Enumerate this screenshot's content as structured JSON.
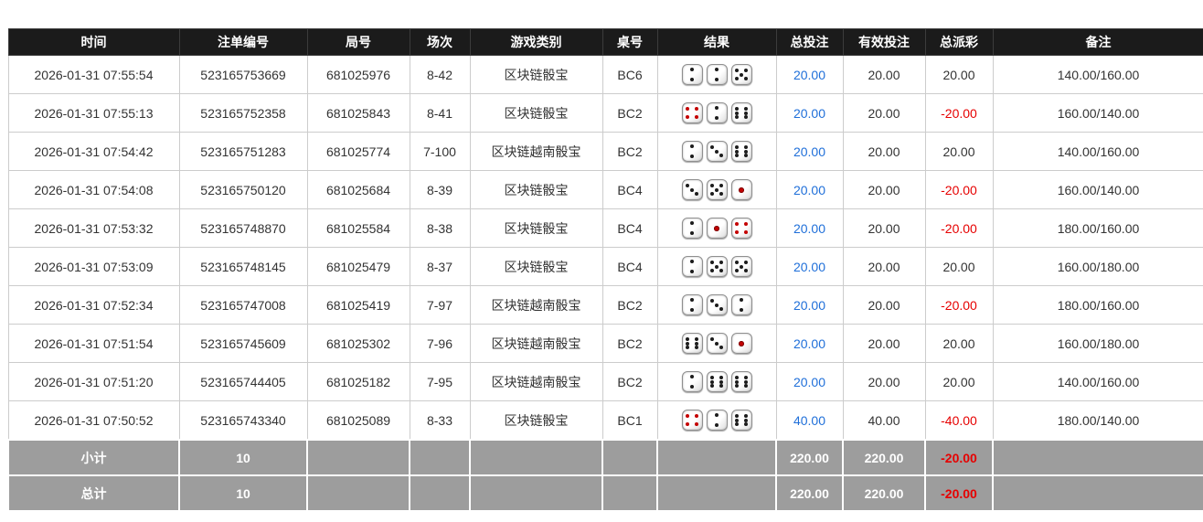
{
  "colors": {
    "link_blue": "#1f6fd9",
    "negative_red": "#e60000",
    "header_bg": "#1b1b1b",
    "summary_bg": "#9d9d9d",
    "grid_border": "#cccccc"
  },
  "table": {
    "headers": [
      "时间",
      "注单编号",
      "局号",
      "场次",
      "游戏类别",
      "桌号",
      "结果",
      "总投注",
      "有效投注",
      "总派彩",
      "备注"
    ],
    "rows": [
      {
        "time": "2026-01-31 07:55:54",
        "bet_id": "523165753669",
        "round_id": "681025976",
        "session": "8-42",
        "game": "区块链骰宝",
        "table_no": "BC6",
        "dice": [
          2,
          2,
          5
        ],
        "total_bet": "20.00",
        "valid_bet": "20.00",
        "payout": "20.00",
        "remark": "140.00/160.00"
      },
      {
        "time": "2026-01-31 07:55:13",
        "bet_id": "523165752358",
        "round_id": "681025843",
        "session": "8-41",
        "game": "区块链骰宝",
        "table_no": "BC2",
        "dice": [
          4,
          2,
          6
        ],
        "total_bet": "20.00",
        "valid_bet": "20.00",
        "payout": "-20.00",
        "remark": "160.00/140.00"
      },
      {
        "time": "2026-01-31 07:54:42",
        "bet_id": "523165751283",
        "round_id": "681025774",
        "session": "7-100",
        "game": "区块链越南骰宝",
        "table_no": "BC2",
        "dice": [
          2,
          3,
          6
        ],
        "total_bet": "20.00",
        "valid_bet": "20.00",
        "payout": "20.00",
        "remark": "140.00/160.00"
      },
      {
        "time": "2026-01-31 07:54:08",
        "bet_id": "523165750120",
        "round_id": "681025684",
        "session": "8-39",
        "game": "区块链骰宝",
        "table_no": "BC4",
        "dice": [
          3,
          5,
          1
        ],
        "total_bet": "20.00",
        "valid_bet": "20.00",
        "payout": "-20.00",
        "remark": "160.00/140.00"
      },
      {
        "time": "2026-01-31 07:53:32",
        "bet_id": "523165748870",
        "round_id": "681025584",
        "session": "8-38",
        "game": "区块链骰宝",
        "table_no": "BC4",
        "dice": [
          2,
          1,
          4
        ],
        "total_bet": "20.00",
        "valid_bet": "20.00",
        "payout": "-20.00",
        "remark": "180.00/160.00"
      },
      {
        "time": "2026-01-31 07:53:09",
        "bet_id": "523165748145",
        "round_id": "681025479",
        "session": "8-37",
        "game": "区块链骰宝",
        "table_no": "BC4",
        "dice": [
          2,
          5,
          5
        ],
        "total_bet": "20.00",
        "valid_bet": "20.00",
        "payout": "20.00",
        "remark": "160.00/180.00"
      },
      {
        "time": "2026-01-31 07:52:34",
        "bet_id": "523165747008",
        "round_id": "681025419",
        "session": "7-97",
        "game": "区块链越南骰宝",
        "table_no": "BC2",
        "dice": [
          2,
          3,
          2
        ],
        "total_bet": "20.00",
        "valid_bet": "20.00",
        "payout": "-20.00",
        "remark": "180.00/160.00"
      },
      {
        "time": "2026-01-31 07:51:54",
        "bet_id": "523165745609",
        "round_id": "681025302",
        "session": "7-96",
        "game": "区块链越南骰宝",
        "table_no": "BC2",
        "dice": [
          6,
          3,
          1
        ],
        "total_bet": "20.00",
        "valid_bet": "20.00",
        "payout": "20.00",
        "remark": "160.00/180.00"
      },
      {
        "time": "2026-01-31 07:51:20",
        "bet_id": "523165744405",
        "round_id": "681025182",
        "session": "7-95",
        "game": "区块链越南骰宝",
        "table_no": "BC2",
        "dice": [
          2,
          6,
          6
        ],
        "total_bet": "20.00",
        "valid_bet": "20.00",
        "payout": "20.00",
        "remark": "140.00/160.00"
      },
      {
        "time": "2026-01-31 07:50:52",
        "bet_id": "523165743340",
        "round_id": "681025089",
        "session": "8-33",
        "game": "区块链骰宝",
        "table_no": "BC1",
        "dice": [
          4,
          2,
          6
        ],
        "total_bet": "40.00",
        "valid_bet": "40.00",
        "payout": "-40.00",
        "remark": "180.00/140.00"
      }
    ],
    "summary_rows": [
      {
        "label": "小计",
        "count": "10",
        "total_bet": "220.00",
        "valid_bet": "220.00",
        "payout": "-20.00"
      },
      {
        "label": "总计",
        "count": "10",
        "total_bet": "220.00",
        "valid_bet": "220.00",
        "payout": "-20.00"
      }
    ]
  }
}
